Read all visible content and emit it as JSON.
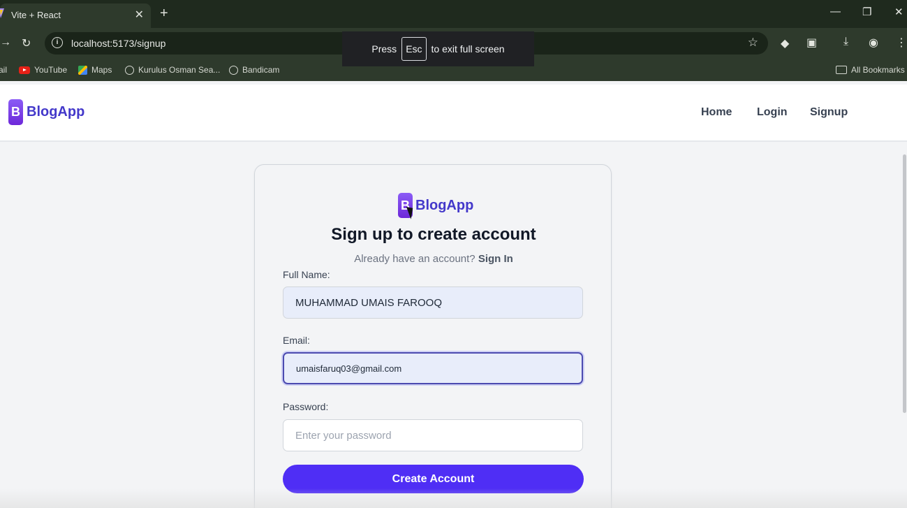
{
  "browser": {
    "tab_title": "Vite + React",
    "tab_close": "✕",
    "new_tab": "+",
    "url": "localhost:5173/signup",
    "bookmarks": [
      "ail",
      "YouTube",
      "Maps",
      "Kurulus Osman Sea...",
      "Bandicam"
    ],
    "all_bookmarks": "All Bookmarks",
    "fullscreen_toast": {
      "press": "Press",
      "key": "Esc",
      "message": "to exit full screen"
    }
  },
  "navbar": {
    "logo_letter": "B",
    "logo_text": "BlogApp",
    "links": [
      "Home",
      "Login",
      "Signup"
    ]
  },
  "signup": {
    "logo_letter": "B",
    "logo_text": "BlogApp",
    "title": "Sign up to create account",
    "subtitle": "Already have an account?",
    "signin_link": "Sign In",
    "fullname_label": "Full Name:",
    "fullname_value": "MUHAMMAD UMAIS FAROOQ",
    "email_label": "Email:",
    "email_value": "umaisfaruq03@gmail.com",
    "password_label": "Password:",
    "password_placeholder": "Enter your password",
    "submit_label": "Create Account"
  },
  "colors": {
    "accent": "#4f2ef5",
    "brand": "#4338ca"
  }
}
